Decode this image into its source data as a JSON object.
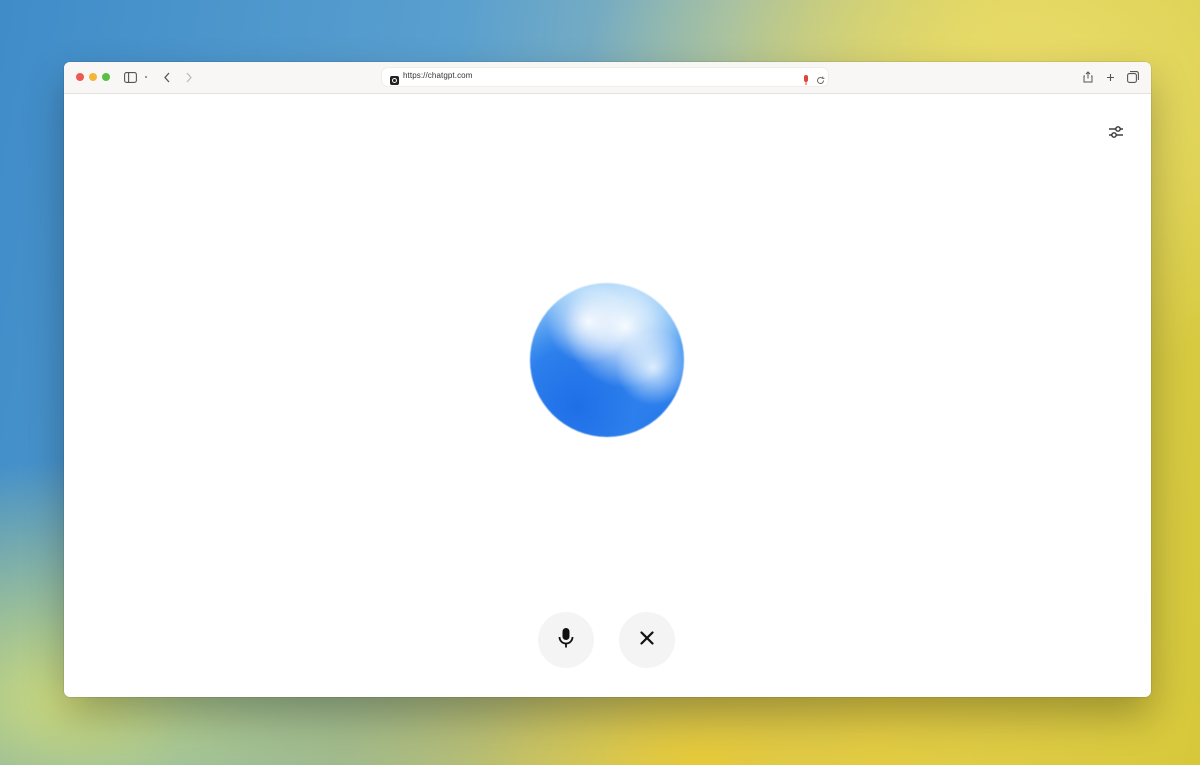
{
  "browser": {
    "url_text": "https://chatgpt.com",
    "window_controls": [
      "close",
      "minimize",
      "zoom"
    ],
    "toolbar_icons_left": [
      "sidebar-icon",
      "chevron-down-icon",
      "back-icon",
      "forward-icon"
    ],
    "toolbar_icons_right": [
      "share-icon",
      "add-tab-icon",
      "tabs-overview-icon"
    ]
  },
  "page": {
    "settings_icon": "sliders-icon",
    "orb": "voice-orb",
    "controls": [
      {
        "name": "mic-button",
        "icon": "microphone-icon"
      },
      {
        "name": "close-button",
        "icon": "close-icon"
      }
    ]
  },
  "colors": {
    "red": "#ec5a52",
    "yellow": "#f2b63a",
    "green": "#57c042",
    "orb_blue": "#1565e6"
  }
}
